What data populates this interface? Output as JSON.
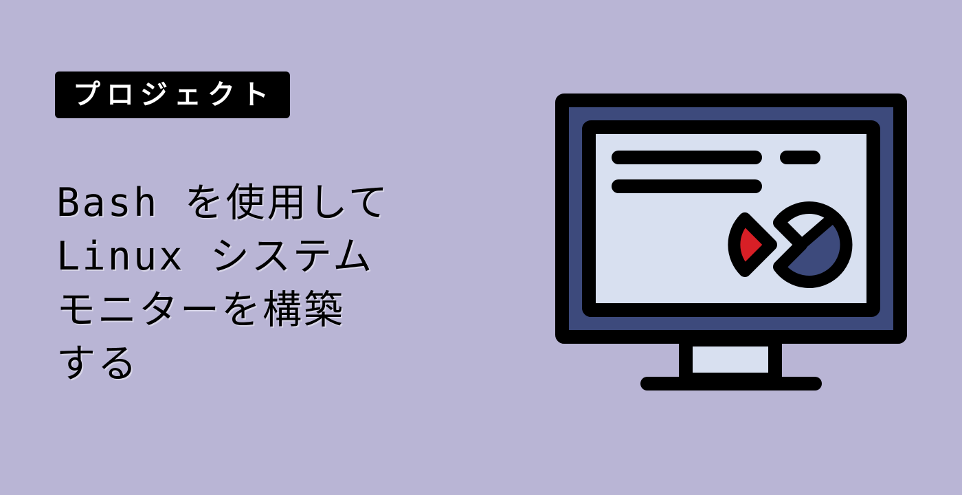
{
  "badge": {
    "label": "プロジェクト"
  },
  "title": {
    "lines": [
      "Bash を使用して",
      "Linux システム",
      "モニターを構築",
      "する"
    ]
  },
  "colors": {
    "background": "#b9b5d5",
    "badge_bg": "#000000",
    "badge_text": "#ffffff",
    "monitor_frame": "#3d4a7c",
    "screen": "#d8e0f0",
    "outline": "#000000",
    "pie_red": "#d81f26",
    "pie_blue": "#3d4a7c"
  },
  "illustration": {
    "icon": "monitor-dashboard-icon"
  }
}
